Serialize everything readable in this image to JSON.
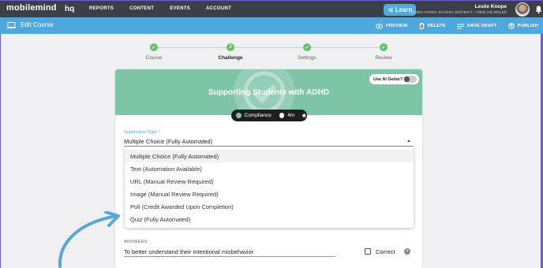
{
  "nav": {
    "logo": "mobilemind",
    "product": "hq",
    "links": [
      "REPORTS",
      "CONTENT",
      "EVENTS",
      "ACCOUNT"
    ],
    "learn_label": "Learn",
    "user_name": "Leslie Knope",
    "user_sub": "GREEN ACRES SCHOOL DISTRICT • VIEW HQ ROLES"
  },
  "subbar": {
    "title": "Edit Course",
    "actions": [
      "PREVIEW",
      "DELETE",
      "SAVE DRAFT",
      "PUBLISH"
    ]
  },
  "stepper": {
    "steps": [
      {
        "label": "Course",
        "state": "done"
      },
      {
        "label": "Challenge",
        "number": "2",
        "state": "active"
      },
      {
        "label": "Settings",
        "state": "done"
      },
      {
        "label": "Review",
        "state": "done"
      }
    ]
  },
  "course": {
    "title": "Supporting Students with ADHD",
    "genie_label": "Use AI Genie?",
    "category": "Compliance",
    "duration": "4m"
  },
  "submission": {
    "label": "Submission Type *",
    "value": "Multiple Choice (Fully Automated)",
    "options": [
      "Multiple Choice (Fully Automated)",
      "Text (Automation Available)",
      "URL (Manual Review Required)",
      "Image (Manual Review Required)",
      "Poll (Credit Awarded Upon Completion)",
      "Quiz (Fully Automated)"
    ]
  },
  "answers": {
    "label": "ANSWERS",
    "first_answer": "To better understand their intentional misbehavior",
    "correct_label": "Correct"
  },
  "colors": {
    "nav_bg": "#3b3f46",
    "accent_blue": "#4ea8dd",
    "banner_green": "#7ec4a6",
    "step_green": "#5cc46b",
    "arrow_blue": "#5aa6d6"
  }
}
